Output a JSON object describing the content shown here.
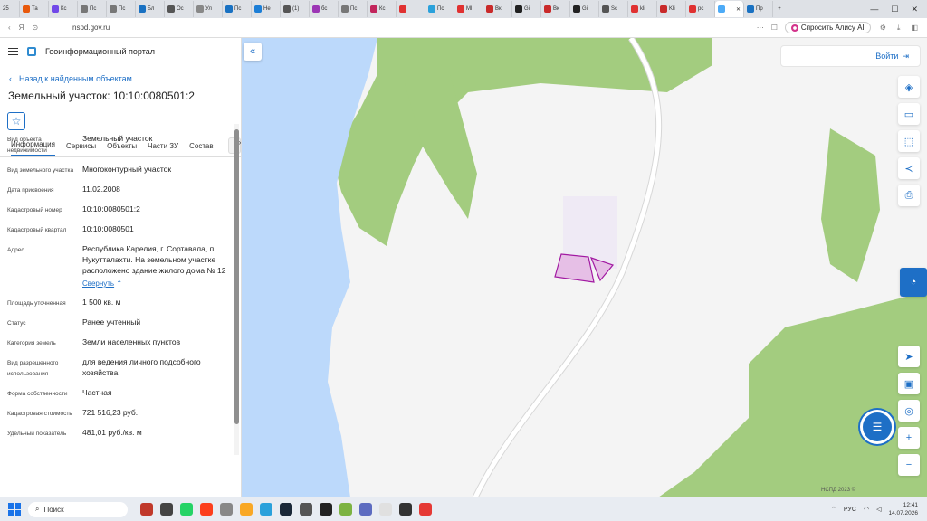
{
  "browser": {
    "tab_count_badge": "25",
    "tabs": [
      "Та",
      "Кс",
      "Пс",
      "Пс",
      "Бл",
      "Ос",
      "Ул",
      "Пс",
      "Не",
      "(1)",
      "бс",
      "Пс",
      "Кс",
      "",
      "Пс",
      "Ml",
      "Вк",
      "Gi",
      "Вк",
      "Gi",
      "Sc",
      "kli",
      "Kli",
      "рс",
      "",
      "Пр"
    ],
    "active_tab_index": 24,
    "url": "nspd.gov.ru",
    "alice_label": "Спросить Алису AI"
  },
  "portal": {
    "title": "Геоинформационный портал",
    "back_label": "Назад к найденным объектам",
    "object_title": "Земельный участок: 10:10:0080501:2",
    "tabs": [
      "Информация",
      "Сервисы",
      "Объекты",
      "Части ЗУ",
      "Состав"
    ],
    "more_arrow": "›",
    "properties": [
      {
        "key": "Вид объекта недвижимости",
        "value": "Земельный участок"
      },
      {
        "key": "Вид земельного участка",
        "value": "Многоконтурный участок"
      },
      {
        "key": "Дата присвоения",
        "value": "11.02.2008"
      },
      {
        "key": "Кадастровый номер",
        "value": "10:10:0080501:2"
      },
      {
        "key": "Кадастровый квартал",
        "value": "10:10:0080501"
      },
      {
        "key": "Адрес",
        "value": "Республика Карелия, г. Сортавала, п. Нукутталахти. На земельном участке расположено здание жилого дома № 12",
        "link": "Свернуть"
      },
      {
        "key": "Площадь уточненная",
        "value": "1 500 кв. м"
      },
      {
        "key": "Статус",
        "value": "Ранее учтенный"
      },
      {
        "key": "Категория земель",
        "value": "Земли населенных пунктов"
      },
      {
        "key": "Вид разрешенного использования",
        "value": "для ведения личного подсобного хозяйства"
      },
      {
        "key": "Форма собственности",
        "value": "Частная"
      },
      {
        "key": "Кадастровая стоимость",
        "value": "721 516,23 руб."
      },
      {
        "key": "Удельный показатель",
        "value": "481,01 руб./кв. м"
      }
    ]
  },
  "map": {
    "login_label": "Войти",
    "attribution": "НСПД 2023 ©",
    "zoom_in": "+",
    "zoom_out": "−"
  },
  "taskbar": {
    "search_placeholder": "Поиск",
    "lang": "РУС",
    "time": "12:41",
    "date": "14.07.2026"
  }
}
